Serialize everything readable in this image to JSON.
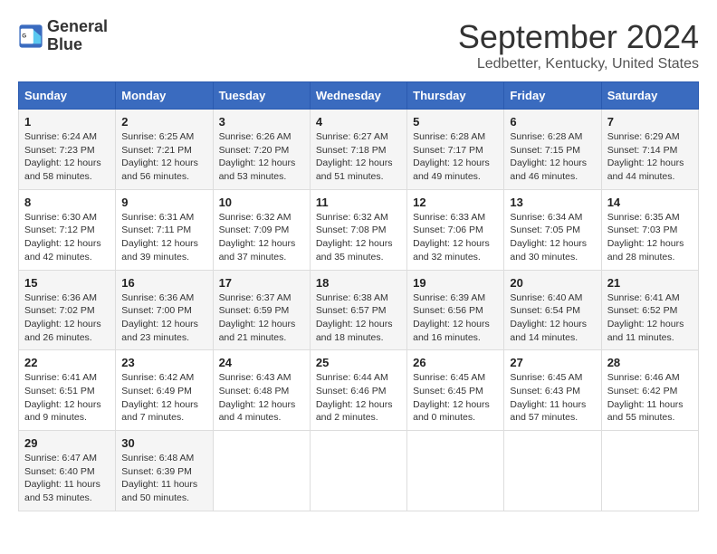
{
  "header": {
    "logo_line1": "General",
    "logo_line2": "Blue",
    "title": "September 2024",
    "subtitle": "Ledbetter, Kentucky, United States"
  },
  "weekdays": [
    "Sunday",
    "Monday",
    "Tuesday",
    "Wednesday",
    "Thursday",
    "Friday",
    "Saturday"
  ],
  "weeks": [
    [
      {
        "day": "1",
        "sunrise": "Sunrise: 6:24 AM",
        "sunset": "Sunset: 7:23 PM",
        "daylight": "Daylight: 12 hours and 58 minutes."
      },
      {
        "day": "2",
        "sunrise": "Sunrise: 6:25 AM",
        "sunset": "Sunset: 7:21 PM",
        "daylight": "Daylight: 12 hours and 56 minutes."
      },
      {
        "day": "3",
        "sunrise": "Sunrise: 6:26 AM",
        "sunset": "Sunset: 7:20 PM",
        "daylight": "Daylight: 12 hours and 53 minutes."
      },
      {
        "day": "4",
        "sunrise": "Sunrise: 6:27 AM",
        "sunset": "Sunset: 7:18 PM",
        "daylight": "Daylight: 12 hours and 51 minutes."
      },
      {
        "day": "5",
        "sunrise": "Sunrise: 6:28 AM",
        "sunset": "Sunset: 7:17 PM",
        "daylight": "Daylight: 12 hours and 49 minutes."
      },
      {
        "day": "6",
        "sunrise": "Sunrise: 6:28 AM",
        "sunset": "Sunset: 7:15 PM",
        "daylight": "Daylight: 12 hours and 46 minutes."
      },
      {
        "day": "7",
        "sunrise": "Sunrise: 6:29 AM",
        "sunset": "Sunset: 7:14 PM",
        "daylight": "Daylight: 12 hours and 44 minutes."
      }
    ],
    [
      {
        "day": "8",
        "sunrise": "Sunrise: 6:30 AM",
        "sunset": "Sunset: 7:12 PM",
        "daylight": "Daylight: 12 hours and 42 minutes."
      },
      {
        "day": "9",
        "sunrise": "Sunrise: 6:31 AM",
        "sunset": "Sunset: 7:11 PM",
        "daylight": "Daylight: 12 hours and 39 minutes."
      },
      {
        "day": "10",
        "sunrise": "Sunrise: 6:32 AM",
        "sunset": "Sunset: 7:09 PM",
        "daylight": "Daylight: 12 hours and 37 minutes."
      },
      {
        "day": "11",
        "sunrise": "Sunrise: 6:32 AM",
        "sunset": "Sunset: 7:08 PM",
        "daylight": "Daylight: 12 hours and 35 minutes."
      },
      {
        "day": "12",
        "sunrise": "Sunrise: 6:33 AM",
        "sunset": "Sunset: 7:06 PM",
        "daylight": "Daylight: 12 hours and 32 minutes."
      },
      {
        "day": "13",
        "sunrise": "Sunrise: 6:34 AM",
        "sunset": "Sunset: 7:05 PM",
        "daylight": "Daylight: 12 hours and 30 minutes."
      },
      {
        "day": "14",
        "sunrise": "Sunrise: 6:35 AM",
        "sunset": "Sunset: 7:03 PM",
        "daylight": "Daylight: 12 hours and 28 minutes."
      }
    ],
    [
      {
        "day": "15",
        "sunrise": "Sunrise: 6:36 AM",
        "sunset": "Sunset: 7:02 PM",
        "daylight": "Daylight: 12 hours and 26 minutes."
      },
      {
        "day": "16",
        "sunrise": "Sunrise: 6:36 AM",
        "sunset": "Sunset: 7:00 PM",
        "daylight": "Daylight: 12 hours and 23 minutes."
      },
      {
        "day": "17",
        "sunrise": "Sunrise: 6:37 AM",
        "sunset": "Sunset: 6:59 PM",
        "daylight": "Daylight: 12 hours and 21 minutes."
      },
      {
        "day": "18",
        "sunrise": "Sunrise: 6:38 AM",
        "sunset": "Sunset: 6:57 PM",
        "daylight": "Daylight: 12 hours and 18 minutes."
      },
      {
        "day": "19",
        "sunrise": "Sunrise: 6:39 AM",
        "sunset": "Sunset: 6:56 PM",
        "daylight": "Daylight: 12 hours and 16 minutes."
      },
      {
        "day": "20",
        "sunrise": "Sunrise: 6:40 AM",
        "sunset": "Sunset: 6:54 PM",
        "daylight": "Daylight: 12 hours and 14 minutes."
      },
      {
        "day": "21",
        "sunrise": "Sunrise: 6:41 AM",
        "sunset": "Sunset: 6:52 PM",
        "daylight": "Daylight: 12 hours and 11 minutes."
      }
    ],
    [
      {
        "day": "22",
        "sunrise": "Sunrise: 6:41 AM",
        "sunset": "Sunset: 6:51 PM",
        "daylight": "Daylight: 12 hours and 9 minutes."
      },
      {
        "day": "23",
        "sunrise": "Sunrise: 6:42 AM",
        "sunset": "Sunset: 6:49 PM",
        "daylight": "Daylight: 12 hours and 7 minutes."
      },
      {
        "day": "24",
        "sunrise": "Sunrise: 6:43 AM",
        "sunset": "Sunset: 6:48 PM",
        "daylight": "Daylight: 12 hours and 4 minutes."
      },
      {
        "day": "25",
        "sunrise": "Sunrise: 6:44 AM",
        "sunset": "Sunset: 6:46 PM",
        "daylight": "Daylight: 12 hours and 2 minutes."
      },
      {
        "day": "26",
        "sunrise": "Sunrise: 6:45 AM",
        "sunset": "Sunset: 6:45 PM",
        "daylight": "Daylight: 12 hours and 0 minutes."
      },
      {
        "day": "27",
        "sunrise": "Sunrise: 6:45 AM",
        "sunset": "Sunset: 6:43 PM",
        "daylight": "Daylight: 11 hours and 57 minutes."
      },
      {
        "day": "28",
        "sunrise": "Sunrise: 6:46 AM",
        "sunset": "Sunset: 6:42 PM",
        "daylight": "Daylight: 11 hours and 55 minutes."
      }
    ],
    [
      {
        "day": "29",
        "sunrise": "Sunrise: 6:47 AM",
        "sunset": "Sunset: 6:40 PM",
        "daylight": "Daylight: 11 hours and 53 minutes."
      },
      {
        "day": "30",
        "sunrise": "Sunrise: 6:48 AM",
        "sunset": "Sunset: 6:39 PM",
        "daylight": "Daylight: 11 hours and 50 minutes."
      },
      null,
      null,
      null,
      null,
      null
    ]
  ]
}
